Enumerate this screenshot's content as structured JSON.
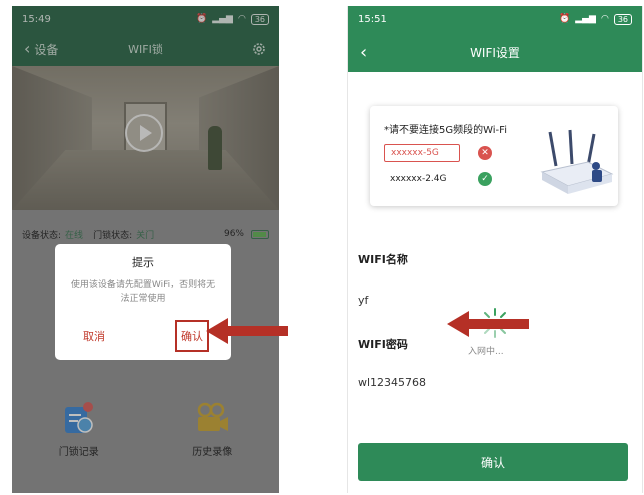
{
  "left": {
    "statusbar": {
      "time": "15:49",
      "battery": "36"
    },
    "nav": {
      "back_label": "设备",
      "title": "WIFI锁"
    },
    "device_status": {
      "label": "设备状态:",
      "value": "在线",
      "lock_label": "门锁状态:",
      "lock_value": "关门",
      "battery_pct": "96%",
      "battery_fill": 0.96
    },
    "tiles": [
      {
        "label": "门锁记录",
        "icon": "lock-record-icon"
      },
      {
        "label": "历史录像",
        "icon": "video-camera-icon"
      }
    ],
    "dialog": {
      "title": "提示",
      "message": "使用该设备请先配置WiFi，否则将无法正常使用",
      "cancel_label": "取消",
      "confirm_label": "确认"
    }
  },
  "right": {
    "statusbar": {
      "time": "15:51",
      "battery": "36"
    },
    "nav": {
      "title": "WIFI设置"
    },
    "tip_card": {
      "warning": "*请不要连接5G频段的Wi-Fi",
      "bad_option": "xxxxxx-5G",
      "good_option": "xxxxxx-2.4G"
    },
    "wifi_name": {
      "label": "WIFI名称",
      "value": "yf"
    },
    "wifi_password": {
      "label": "WIFI密码",
      "value": "wl12345768"
    },
    "loading_text": "入网中...",
    "confirm_label": "确认"
  },
  "colors": {
    "brand_green": "#2e8a58",
    "dark_green": "#1e5f3c",
    "warning_red": "#d9534f",
    "annotation_red": "#b53026"
  }
}
